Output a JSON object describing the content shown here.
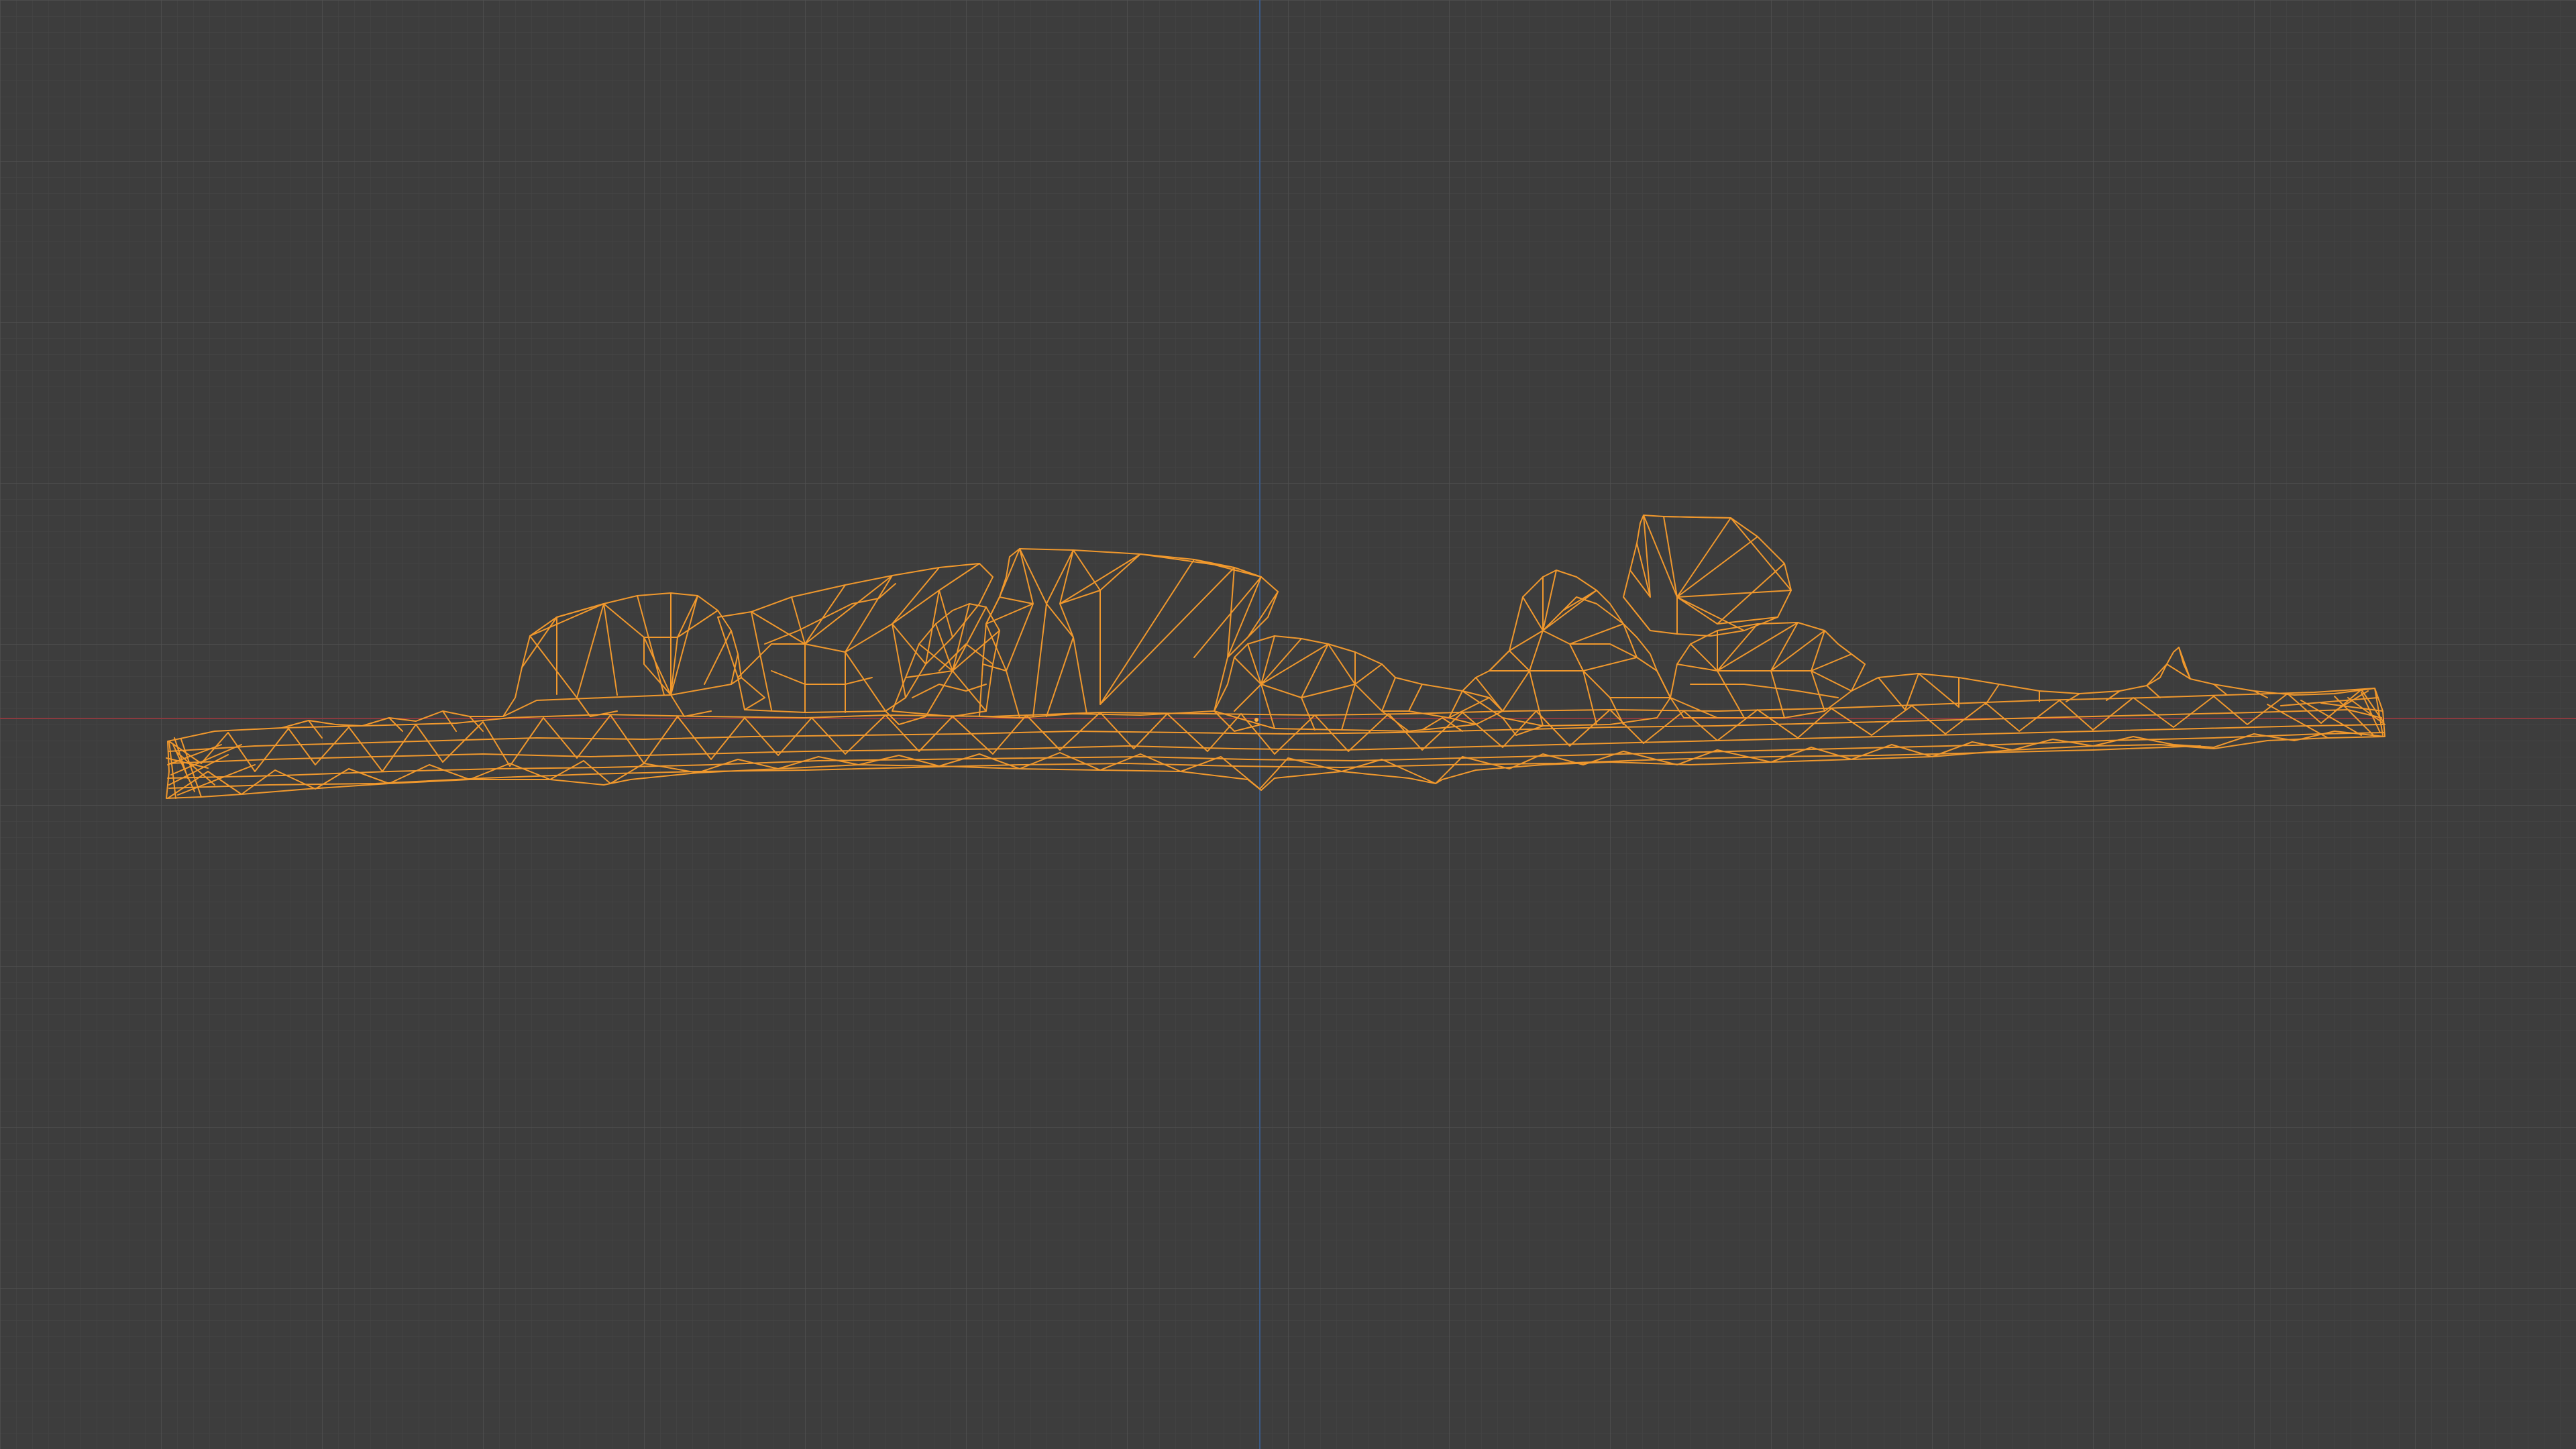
{
  "app": {
    "view": "3d-viewport-front-orthographic",
    "shading": "wireframe",
    "selection_state": "selected-object-wireframe"
  },
  "colors": {
    "background": "#3d3d3d",
    "grid_minor": "#474747",
    "grid_major": "#515151",
    "axis_x": "#8b3a3f",
    "axis_z": "#3b5a85",
    "wireframe": "#f0982d",
    "wireframe_bright": "#ffad3d"
  },
  "icons": {
    "mesh": "wireframe-mesh",
    "origin": "object-origin-dot"
  }
}
